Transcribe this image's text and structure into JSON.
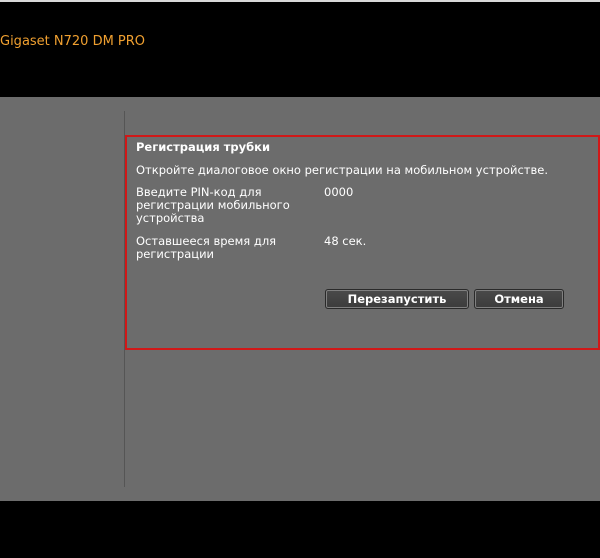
{
  "header": {
    "brand": "Gigaset N720 DM PRO"
  },
  "dialog": {
    "title": "Регистрация трубки",
    "message": "Откройте диалоговое окно регистрации на мобильном устройстве.",
    "pin_label": "Введите PIN-код для регистрации мобильного устройства",
    "pin_value": "0000",
    "time_label": "Оставшееся время для регистрации",
    "time_value": "48 сек.",
    "restart_label": "Перезапустить",
    "cancel_label": "Отмена"
  },
  "colors": {
    "brand": "#f0a030",
    "dialog_border": "#d01818",
    "panel_background": "#6c6c6c"
  }
}
